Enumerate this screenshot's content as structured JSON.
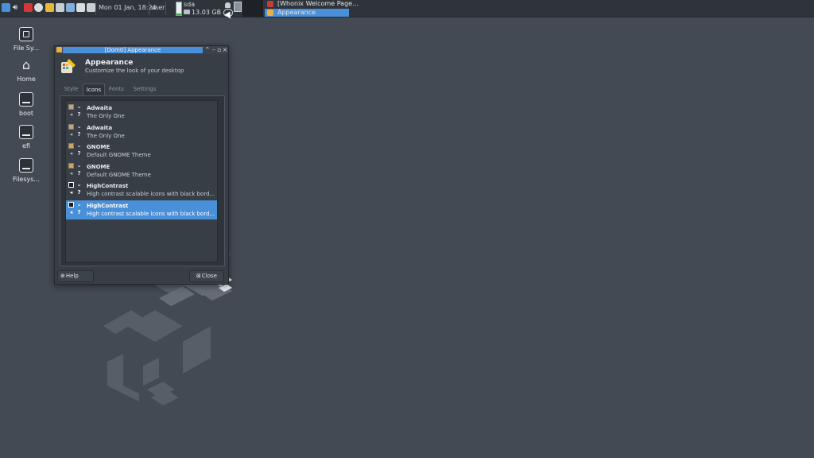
{
  "panel": {
    "clock": "Mon 01 Jan, 18:24",
    "user": "user",
    "disk": {
      "name": "sda",
      "size": "13.03 GB",
      "usage_fraction": 0.12
    },
    "tray_icons": [
      "app-menu-icon",
      "volume-icon",
      "network-icon",
      "qubes-icon",
      "disk-icon",
      "window-icon",
      "domain-icon",
      "clipboard-icon",
      "screenshot-icon"
    ],
    "tasks": [
      {
        "label": "[Whonix Welcome Page...",
        "active": false
      },
      {
        "label": "Appearance",
        "active": true
      }
    ]
  },
  "desktop": {
    "icons": [
      {
        "label": "File Sy...",
        "icon": "file-system-icon"
      },
      {
        "label": "Home",
        "icon": "home-icon"
      },
      {
        "label": "boot",
        "icon": "drive-icon"
      },
      {
        "label": "efi",
        "icon": "drive-icon"
      },
      {
        "label": "Filesys...",
        "icon": "drive-icon"
      }
    ]
  },
  "window": {
    "title": "[Dom0] Appearance",
    "header_title": "Appearance",
    "header_subtitle": "Customize the look of your desktop",
    "tabs": [
      "Style",
      "Icons",
      "Fonts",
      "Settings"
    ],
    "active_tab": "Icons",
    "themes": [
      {
        "name": "Adwaita",
        "desc": "The Only One",
        "selected": false
      },
      {
        "name": "Adwaita",
        "desc": "The Only One",
        "selected": false
      },
      {
        "name": "GNOME",
        "desc": "Default GNOME Theme",
        "selected": false
      },
      {
        "name": "GNOME",
        "desc": "Default GNOME Theme",
        "selected": false
      },
      {
        "name": "HighContrast",
        "desc": "High contrast scalable icons with black bord...",
        "selected": false
      },
      {
        "name": "HighContrast",
        "desc": "High contrast scalable icons with black bord...",
        "selected": true
      }
    ],
    "help_label": "Help",
    "close_label": "Close"
  },
  "colors": {
    "desktop": "#434a53",
    "panel": "#2f343a",
    "accent": "#4a90d9",
    "window": "#383e45"
  }
}
